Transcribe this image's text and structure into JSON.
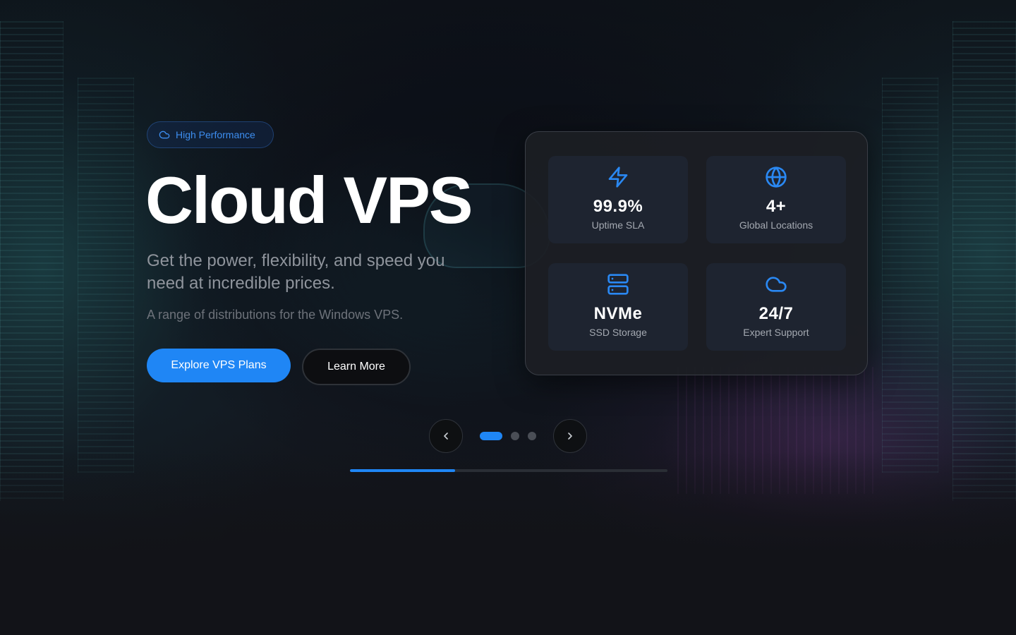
{
  "hero": {
    "badge_label": "High Performance",
    "badge_icon": "cloud-icon",
    "title": "Cloud VPS",
    "subtitle": "Get the power, flexibility, and speed you need at incredible prices.",
    "description": "A range of distributions for the Windows VPS.",
    "primary_button": "Explore VPS Plans",
    "secondary_button": "Learn More"
  },
  "stats": [
    {
      "icon": "lightning-icon",
      "value": "99.9%",
      "label": "Uptime SLA"
    },
    {
      "icon": "globe-icon",
      "value": "4+",
      "label": "Global Locations"
    },
    {
      "icon": "server-icon",
      "value": "NVMe",
      "label": "SSD Storage"
    },
    {
      "icon": "cloud-icon",
      "value": "24/7",
      "label": "Expert Support"
    }
  ],
  "carousel": {
    "slide_count": 3,
    "active_slide": 1,
    "progress": 0.33
  },
  "colors": {
    "accent": "#1f86f5",
    "background": "#121318",
    "panel": "#1c1e24",
    "card": "#1e2430",
    "muted_text": "#8f949c"
  }
}
